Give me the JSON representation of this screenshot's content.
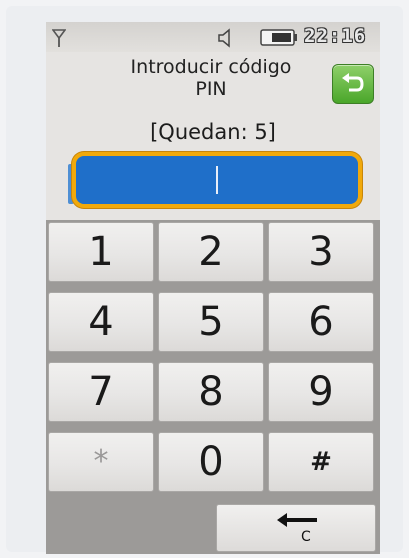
{
  "status_bar": {
    "time": "22:16",
    "icons": [
      "signal-icon",
      "speaker-icon",
      "battery-icon"
    ]
  },
  "header": {
    "title_line1": "Introducir código",
    "title_line2": "PIN",
    "back_icon": "back-arrow-icon"
  },
  "attempts": {
    "label": "[Quedan: 5]"
  },
  "pin_field": {
    "value": ""
  },
  "keypad": {
    "keys": [
      "1",
      "2",
      "3",
      "4",
      "5",
      "6",
      "7",
      "8",
      "9",
      "*",
      "0",
      "#"
    ],
    "clear_label": "C",
    "clear_icon": "backspace-arrow-icon"
  },
  "colors": {
    "field_fill": "#1f6fc9",
    "field_border": "#f1a90b",
    "back_button": "#4aa62a"
  }
}
